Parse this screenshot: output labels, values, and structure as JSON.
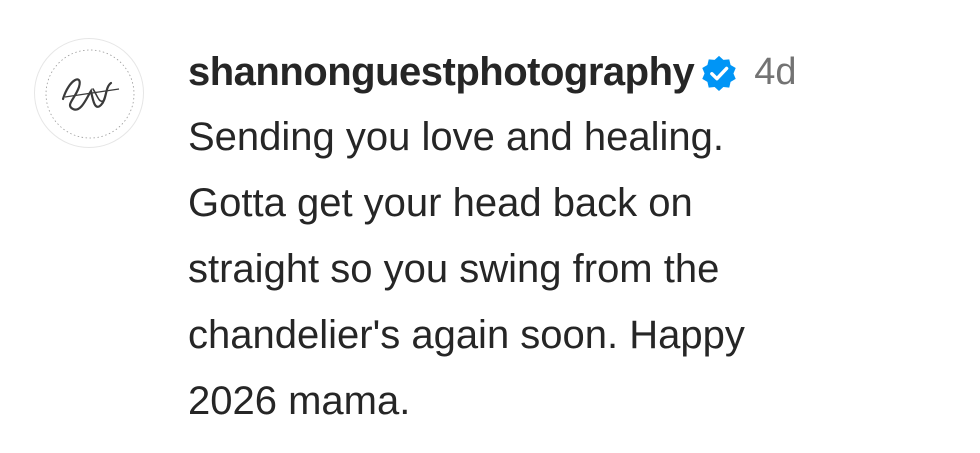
{
  "comment": {
    "username": "shannonguestphotography",
    "verified": true,
    "time": "4d",
    "text": "Sending you love and healing.\nGotta get your head back on\nstraight so you swing from the\nchandelier's again soon. Happy\n2026 mama.",
    "avatar": {
      "icon": "monogram-logo-avatar",
      "monogram": "SG"
    }
  },
  "colors": {
    "text": "#262626",
    "secondary": "#737373",
    "verified_badge": "#0095f6"
  }
}
